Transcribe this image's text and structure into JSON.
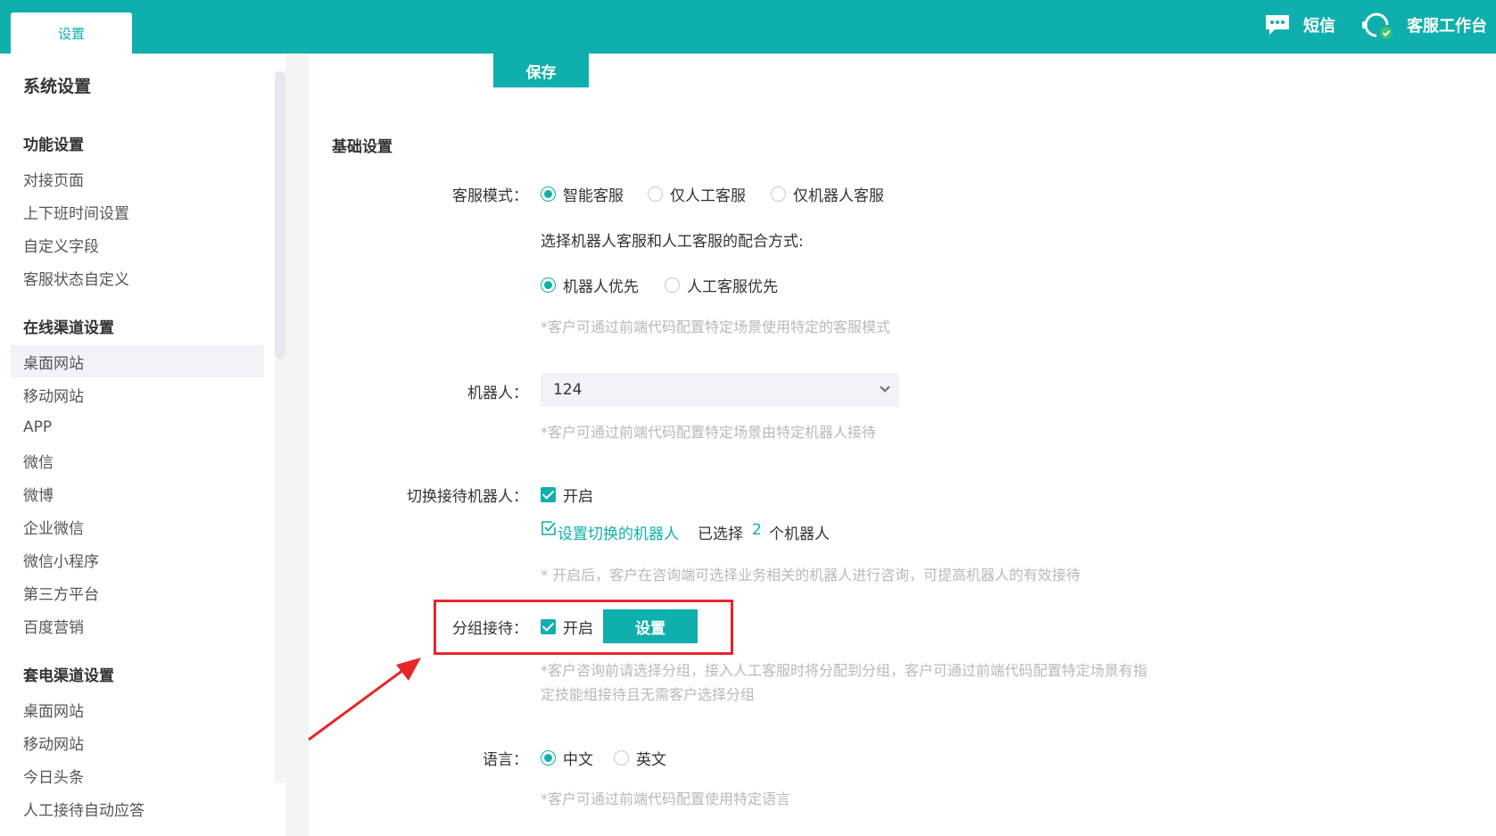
{
  "topbar": {
    "tab": "设置",
    "sms_label": "短信",
    "workspace_label": "客服工作台"
  },
  "sidebar": {
    "title": "系统设置",
    "groups": [
      {
        "title": "功能设置",
        "items": [
          "对接页面",
          "上下班时间设置",
          "自定义字段",
          "客服状态自定义"
        ]
      },
      {
        "title": "在线渠道设置",
        "items": [
          "桌面网站",
          "移动网站",
          "APP",
          "微信",
          "微博",
          "企业微信",
          "微信小程序",
          "第三方平台",
          "百度营销"
        ]
      },
      {
        "title": "套电渠道设置",
        "items": [
          "桌面网站",
          "移动网站",
          "今日头条",
          "人工接待自动应答"
        ]
      }
    ],
    "active_item": "桌面网站"
  },
  "main": {
    "save_label": "保存",
    "section_title": "基础设置",
    "service_mode": {
      "label": "客服模式：",
      "options": [
        "智能客服",
        "仅人工客服",
        "仅机器人客服"
      ],
      "selected": "智能客服",
      "sub_title": "选择机器人客服和人工客服的配合方式:",
      "sub_options": [
        "机器人优先",
        "人工客服优先"
      ],
      "sub_selected": "机器人优先",
      "hint": "*客户可通过前端代码配置特定场景使用特定的客服模式"
    },
    "robot": {
      "label": "机器人：",
      "value": "124",
      "hint": "*客户可通过前端代码配置特定场景由特定机器人接待"
    },
    "switch_robot": {
      "label": "切换接待机器人：",
      "checkbox_label": "开启",
      "link_label": "设置切换的机器人",
      "selected_prefix": "已选择",
      "selected_count": "2",
      "selected_suffix": "个机器人",
      "hint": "* 开启后，客户在咨询端可选择业务相关的机器人进行咨询，可提高机器人的有效接待"
    },
    "group_reception": {
      "label": "分组接待：",
      "checkbox_label": "开启",
      "button_label": "设置",
      "hint_line1": "*客户咨询前请选择分组，接入人工客服时将分配到分组，客户可通过前端代码配置特定场景有指",
      "hint_line2": "定技能组接待且无需客户选择分组"
    },
    "language": {
      "label": "语言：",
      "options": [
        "中文",
        "英文"
      ],
      "selected": "中文",
      "hint": "*客户可通过前端代码配置使用特定语言"
    }
  },
  "colors": {
    "accent": "#0fafad",
    "highlight": "#e6262b",
    "hint_text": "#b5b9bd"
  }
}
